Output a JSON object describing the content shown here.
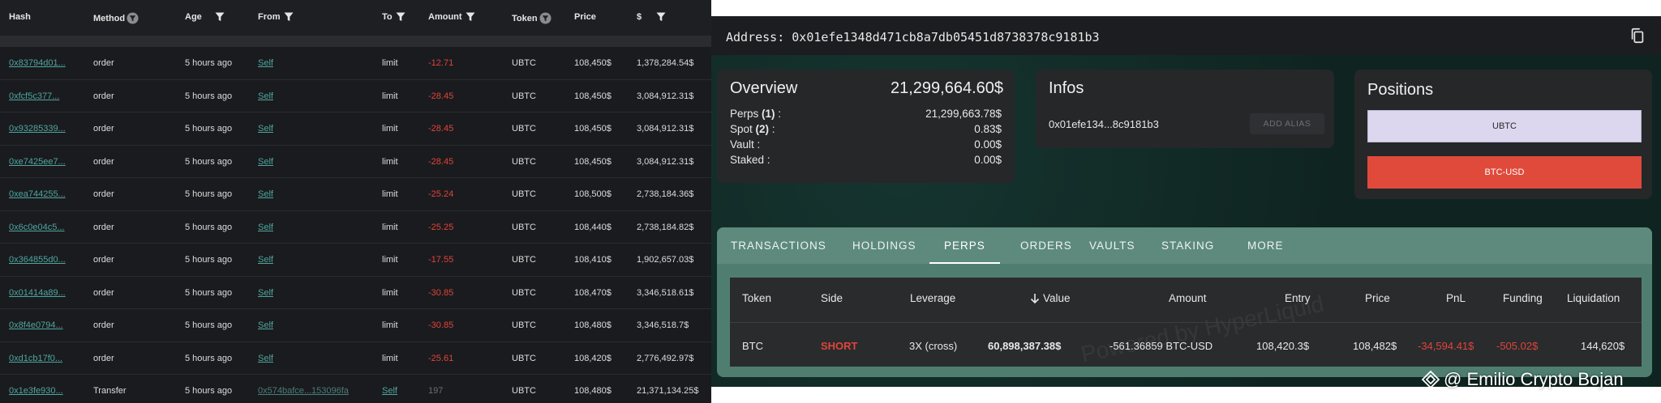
{
  "tx_table": {
    "headers": {
      "hash": "Hash",
      "method": "Method",
      "age": "Age",
      "from": "From",
      "to": "To",
      "amount": "Amount",
      "token": "Token",
      "price": "Price",
      "usd": "$"
    },
    "rows": [
      {
        "hash": "0x83794d01...",
        "method": "order",
        "age": "5 hours ago",
        "from": "Self",
        "to": "limit",
        "amount": "-12.71",
        "token": "UBTC",
        "price": "108,450$",
        "usd": "1,378,284.54$"
      },
      {
        "hash": "0xfcf5c377...",
        "method": "order",
        "age": "5 hours ago",
        "from": "Self",
        "to": "limit",
        "amount": "-28.45",
        "token": "UBTC",
        "price": "108,450$",
        "usd": "3,084,912.31$"
      },
      {
        "hash": "0x93285339...",
        "method": "order",
        "age": "5 hours ago",
        "from": "Self",
        "to": "limit",
        "amount": "-28.45",
        "token": "UBTC",
        "price": "108,450$",
        "usd": "3,084,912.31$"
      },
      {
        "hash": "0xe7425ee7...",
        "method": "order",
        "age": "5 hours ago",
        "from": "Self",
        "to": "limit",
        "amount": "-28.45",
        "token": "UBTC",
        "price": "108,450$",
        "usd": "3,084,912.31$"
      },
      {
        "hash": "0xea744255...",
        "method": "order",
        "age": "5 hours ago",
        "from": "Self",
        "to": "limit",
        "amount": "-25.24",
        "token": "UBTC",
        "price": "108,500$",
        "usd": "2,738,184.36$"
      },
      {
        "hash": "0x6c0e04c5...",
        "method": "order",
        "age": "5 hours ago",
        "from": "Self",
        "to": "limit",
        "amount": "-25.25",
        "token": "UBTC",
        "price": "108,440$",
        "usd": "2,738,184.82$"
      },
      {
        "hash": "0x364855d0...",
        "method": "order",
        "age": "5 hours ago",
        "from": "Self",
        "to": "limit",
        "amount": "-17.55",
        "token": "UBTC",
        "price": "108,410$",
        "usd": "1,902,657.03$"
      },
      {
        "hash": "0x01414a89...",
        "method": "order",
        "age": "5 hours ago",
        "from": "Self",
        "to": "limit",
        "amount": "-30.85",
        "token": "UBTC",
        "price": "108,470$",
        "usd": "3,346,518.61$"
      },
      {
        "hash": "0x8f4e0794...",
        "method": "order",
        "age": "5 hours ago",
        "from": "Self",
        "to": "limit",
        "amount": "-30.85",
        "token": "UBTC",
        "price": "108,480$",
        "usd": "3,346,518.7$"
      },
      {
        "hash": "0xd1cb17f0...",
        "method": "order",
        "age": "5 hours ago",
        "from": "Self",
        "to": "limit",
        "amount": "-25.61",
        "token": "UBTC",
        "price": "108,420$",
        "usd": "2,776,492.97$"
      }
    ],
    "last_row": {
      "hash": "0x1e3fe930...",
      "method": "Transfer",
      "age": "5 hours ago",
      "from": "0x574bafce...153096fa",
      "to": "Self",
      "amount": "197",
      "token": "UBTC",
      "price": "108,480$",
      "usd": "21,371,134.25$"
    }
  },
  "explorer": {
    "address_label": "Address:  0x01efe1348d471cb8a7db05451d8738378c9181b3",
    "overview": {
      "title": "Overview",
      "total": "21,299,664.60$",
      "rows": [
        {
          "label": "Perps ",
          "count": "(1)",
          "suffix": " :",
          "value": "21,299,663.78$"
        },
        {
          "label": "Spot ",
          "count": "(2)",
          "suffix": " :",
          "value": "0.83$"
        },
        {
          "label": "Vault :",
          "count": "",
          "suffix": "",
          "value": "0.00$"
        },
        {
          "label": "Staked :",
          "count": "",
          "suffix": "",
          "value": "0.00$"
        }
      ]
    },
    "infos": {
      "title": "Infos",
      "short_address": "0x01efe134...8c9181b3",
      "alias_button": "ADD ALIAS"
    },
    "positions": {
      "title": "Positions",
      "items": [
        "UBTC",
        "BTC-USD"
      ]
    },
    "tabs": [
      "TRANSACTIONS",
      "HOLDINGS",
      "PERPS",
      "ORDERS",
      "VAULTS",
      "STAKING",
      "MORE"
    ],
    "active_tab": "PERPS",
    "perps_table": {
      "headers": {
        "token": "Token",
        "side": "Side",
        "leverage": "Leverage",
        "value": "Value",
        "amount": "Amount",
        "entry": "Entry",
        "price": "Price",
        "pnl": "PnL",
        "funding": "Funding",
        "liquidation": "Liquidation"
      },
      "row": {
        "token": "BTC",
        "side": "SHORT",
        "leverage": "3X (cross)",
        "value": "60,898,387.38$",
        "amount": "-561.36859 BTC-USD",
        "entry": "108,420.3$",
        "price": "108,482$",
        "pnl": "-34,594.41$",
        "funding": "-505.02$",
        "liquidation": "144,620$"
      }
    },
    "watermark": "Powered by HyperLiquid",
    "credit": "@ Emilio Crypto Bojan"
  },
  "colors": {
    "negative": "#e0443a",
    "link": "#4fa6a0",
    "tab_bar": "#5d8a7c",
    "position_short": "#e04a3b",
    "position_long": "#dcd6ee"
  }
}
